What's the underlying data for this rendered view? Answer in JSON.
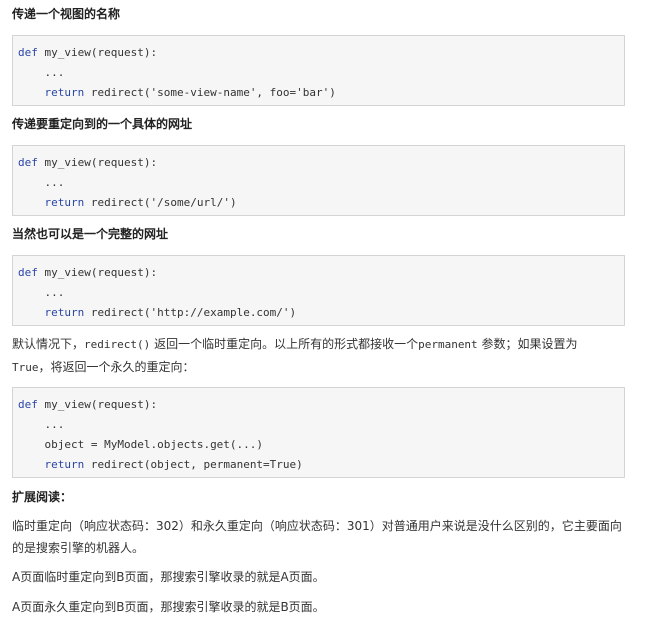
{
  "sections": [
    {
      "heading": "传递一个视图的名称",
      "code": [
        {
          "kw": "def",
          "rest": " my_view(request):"
        },
        {
          "indent": "    ",
          "rest": "..."
        },
        {
          "indent": "    ",
          "kw": "return",
          "rest": " redirect('some-view-name', foo='bar')"
        }
      ]
    },
    {
      "heading": "传递要重定向到的一个具体的网址",
      "code": [
        {
          "kw": "def",
          "rest": " my_view(request):"
        },
        {
          "indent": "    ",
          "rest": "..."
        },
        {
          "indent": "    ",
          "kw": "return",
          "rest": " redirect('/some/url/')"
        }
      ]
    },
    {
      "heading": "当然也可以是一个完整的网址",
      "code": [
        {
          "kw": "def",
          "rest": " my_view(request):"
        },
        {
          "indent": "    ",
          "rest": "..."
        },
        {
          "indent": "    ",
          "kw": "return",
          "rest": " redirect('http://example.com/')"
        }
      ]
    }
  ],
  "explain": {
    "part1": "默认情况下，",
    "code1": "redirect()",
    "part2": " 返回一个临时重定向。以上所有的形式都接收一个",
    "code2": "permanent",
    "part3": " 参数；如果设置为",
    "code3": "True",
    "part4": "，将返回一个永久的重定向："
  },
  "code4": [
    {
      "kw": "def",
      "rest": " my_view(request):"
    },
    {
      "indent": "    ",
      "rest": "..."
    },
    {
      "indent": "    ",
      "rest": "object = MyModel.objects.get(...)"
    },
    {
      "indent": "    ",
      "kw": "return",
      "rest": " redirect(object, permanent=True)"
    }
  ],
  "extended": {
    "heading": "扩展阅读：",
    "p1": "临时重定向（响应状态码：302）和永久重定向（响应状态码：301）对普通用户来说是没什么区别的，它主要面向的是搜索引擎的机器人。",
    "p2": "A页面临时重定向到B页面，那搜索引擎收录的就是A页面。",
    "p3": "A页面永久重定向到B页面，那搜索引擎收录的就是B页面。"
  },
  "colors": {
    "keyword": "#2a46a6",
    "code_bg": "#f6f6f6",
    "code_border": "#d4d4d4"
  }
}
